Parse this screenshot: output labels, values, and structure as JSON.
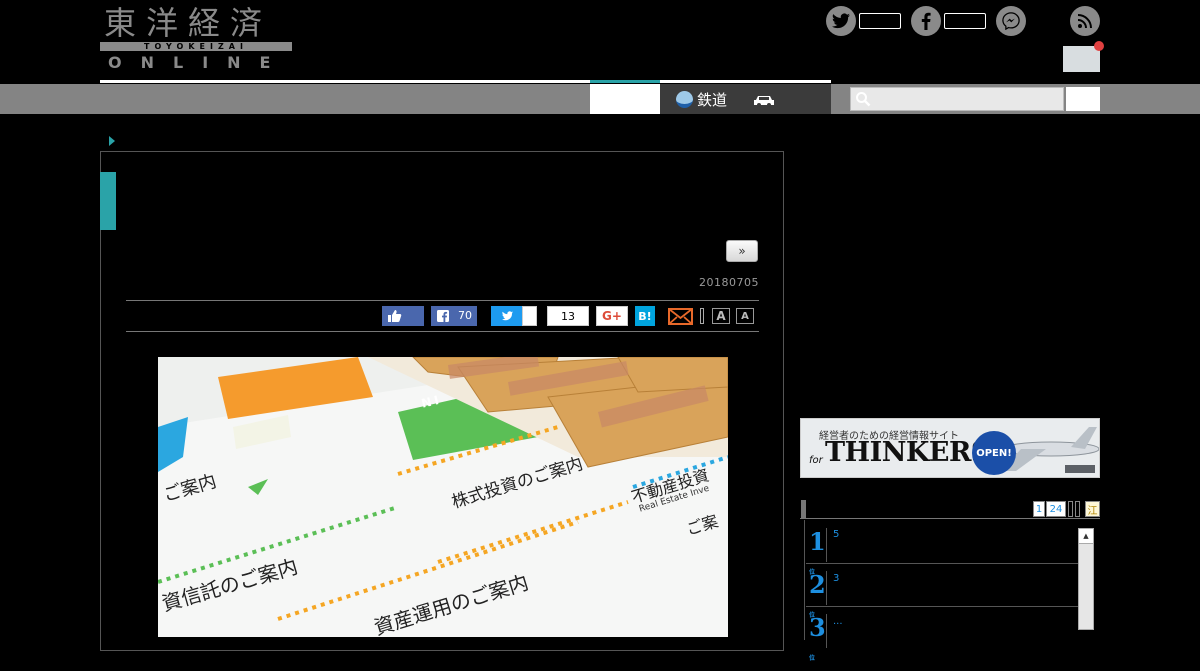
{
  "header": {
    "logo_kanji": "東洋経済",
    "logo_romaji": "TOYOKEIZAI",
    "logo_online": "ONLINE"
  },
  "nav": {
    "rail_label": "鉄道",
    "search_placeholder": ""
  },
  "article": {
    "next_label": "»",
    "date": "20180705"
  },
  "share": {
    "fb_count": "70",
    "pocket_count": "13",
    "gplus_label": "G+",
    "hatena_label": "B!",
    "font_large": "A",
    "font_small": "A"
  },
  "hero": {
    "card_text_1": "資産運用のご案内",
    "card_text_2": "資信託のご案内",
    "card_text_3": "株式投資のご案内",
    "card_text_4": "不動産投資",
    "card_text_5": "ご案内",
    "card_text_6": "NI",
    "card_text_7": "Real Estate Inve",
    "card_text_8": "ご案"
  },
  "ad": {
    "tagline": "経営者のための経営情報サイト",
    "brand": "THINKERS",
    "brand_prefix": "for",
    "open_label": "OPEN!"
  },
  "ranking": {
    "tabs": [
      "1",
      "24"
    ],
    "tab_last": "江",
    "items": [
      {
        "rank": "1",
        "sub": "位",
        "count": "5"
      },
      {
        "rank": "2",
        "sub": "位",
        "count": "3"
      },
      {
        "rank": "3",
        "sub": "位",
        "count": "..."
      }
    ]
  },
  "colors": {
    "accent_teal": "#2aa3a8",
    "ranking_blue": "#1d8fe0",
    "facebook": "#4a67ad",
    "twitter": "#1d9bf0",
    "hatena": "#00a4de",
    "notification": "#e04040"
  }
}
